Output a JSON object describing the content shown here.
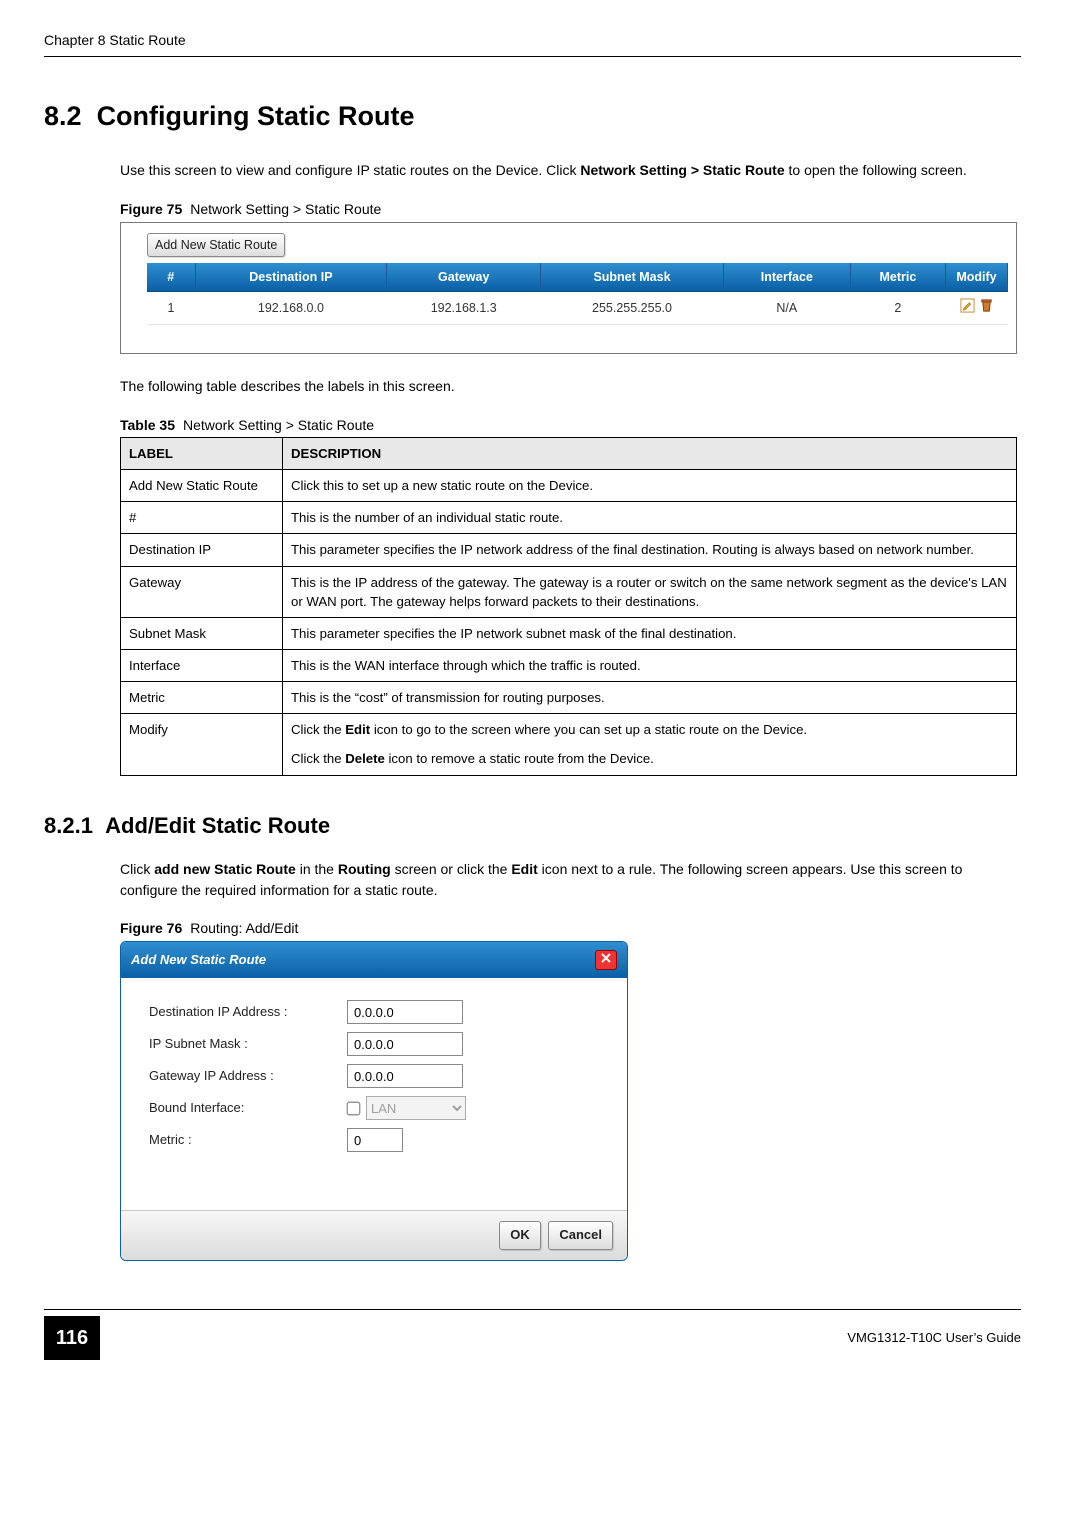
{
  "header": {
    "chapter": "Chapter 8 Static Route"
  },
  "section": {
    "number": "8.2",
    "title": "Configuring Static Route",
    "intro_pre": "Use this screen to view and configure IP static routes on the Device. Click ",
    "intro_bold": "Network Setting > Static Route",
    "intro_post": " to open the following screen."
  },
  "figure75": {
    "label": "Figure 75",
    "caption": "Network Setting > Static Route",
    "add_button": "Add New Static Route",
    "columns": [
      "#",
      "Destination IP",
      "Gateway",
      "Subnet Mask",
      "Interface",
      "Metric",
      "Modify"
    ],
    "rows": [
      {
        "num": "1",
        "dest": "192.168.0.0",
        "gw": "192.168.1.3",
        "mask": "255.255.255.0",
        "iface": "N/A",
        "metric": "2"
      }
    ]
  },
  "table_intro": "The following table describes the labels in this screen.",
  "table35": {
    "label": "Table 35",
    "caption": "Network Setting > Static Route",
    "head_label": "LABEL",
    "head_desc": "DESCRIPTION",
    "rows": [
      {
        "label": "Add New Static Route",
        "desc": "Click this to set up a new static route on the Device."
      },
      {
        "label": "#",
        "desc": "This is the number of an individual static route."
      },
      {
        "label": "Destination IP",
        "desc": "This parameter specifies the IP network address of the final destination. Routing is always based on network number."
      },
      {
        "label": "Gateway",
        "desc": "This is the IP address of the gateway. The gateway is a router or switch on the same network segment as the device's LAN or WAN port. The gateway helps forward packets to their destinations."
      },
      {
        "label": "Subnet Mask",
        "desc": "This parameter specifies the IP network subnet mask of the final destination."
      },
      {
        "label": "Interface",
        "desc": "This is the WAN interface through which the traffic is routed."
      },
      {
        "label": "Metric",
        "desc": "This is the “cost” of transmission for routing purposes."
      }
    ],
    "modify_row": {
      "label": "Modify",
      "p1_pre": "Click the ",
      "p1_bold": "Edit",
      "p1_post": " icon to go to the screen where you can set up a static route on the Device.",
      "p2_pre": "Click the ",
      "p2_bold": "Delete",
      "p2_post": " icon to remove a static route from the Device."
    }
  },
  "section821": {
    "number": "8.2.1",
    "title": "Add/Edit Static Route",
    "p_pre": "Click ",
    "p_b1": "add new Static Route",
    "p_mid1": " in the ",
    "p_b2": "Routing",
    "p_mid2": " screen or click the ",
    "p_b3": "Edit",
    "p_post": " icon next to a rule. The following screen appears. Use this screen to configure the required information for a static route."
  },
  "figure76": {
    "label": "Figure 76",
    "caption": "Routing: Add/Edit",
    "dialog_title": "Add New Static Route",
    "fields": {
      "dest_label": "Destination IP Address :",
      "dest_value": "0.0.0.0",
      "mask_label": "IP Subnet Mask :",
      "mask_value": "0.0.0.0",
      "gw_label": "Gateway IP Address :",
      "gw_value": "0.0.0.0",
      "iface_label": "Bound Interface:",
      "iface_option": "LAN",
      "metric_label": "Metric :",
      "metric_value": "0"
    },
    "ok": "OK",
    "cancel": "Cancel"
  },
  "footer": {
    "page": "116",
    "guide": "VMG1312-T10C User’s Guide"
  }
}
